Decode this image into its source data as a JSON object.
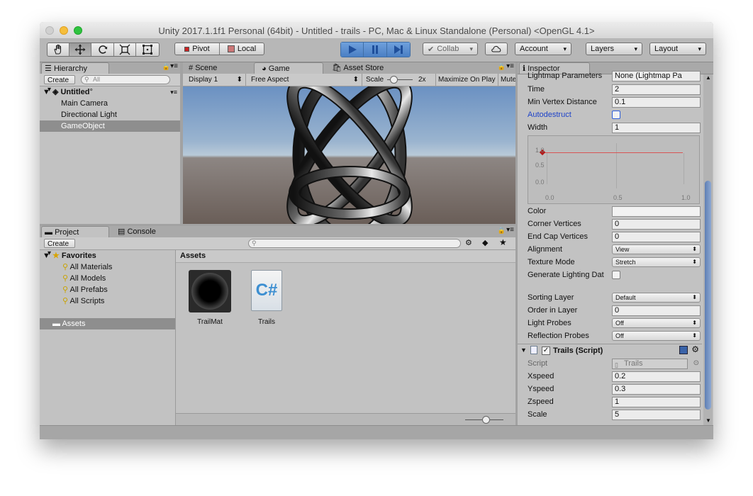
{
  "window": {
    "title": "Unity 2017.1.1f1 Personal (64bit) - Untitled - trails - PC, Mac & Linux Standalone (Personal) <OpenGL 4.1>"
  },
  "toolbar": {
    "tools": [
      "hand-icon",
      "move-icon",
      "rotate-icon",
      "scale-icon",
      "rect-tool-icon"
    ],
    "pivot": "Pivot",
    "local": "Local",
    "collab": "Collab",
    "account": "Account",
    "layers": "Layers",
    "layout": "Layout"
  },
  "hierarchy": {
    "tab": "Hierarchy",
    "create": "Create",
    "search_placeholder": "All",
    "scene_name": "Untitled",
    "items": [
      "Main Camera",
      "Directional Light",
      "GameObject"
    ],
    "selected_index": 2
  },
  "game_view": {
    "tabs": [
      "Scene",
      "Game",
      "Asset Store"
    ],
    "display": "Display 1",
    "aspect": "Free Aspect",
    "scale_label": "Scale",
    "scale_value": "2x",
    "maximize": "Maximize On Play",
    "mute": "Mute",
    "colors": {
      "sky_top": "#6b91c2",
      "sky_bottom": "#b9cad8",
      "ground": "#6a5e58"
    }
  },
  "project": {
    "tabs": [
      "Project",
      "Console"
    ],
    "create": "Create",
    "favorites_label": "Favorites",
    "favorites": [
      "All Materials",
      "All Models",
      "All Prefabs",
      "All Scripts"
    ],
    "assets_folder": "Assets",
    "breadcrumb": "Assets",
    "assets": [
      {
        "name": "TrailMat",
        "icon": "material-sphere-icon"
      },
      {
        "name": "Trails",
        "icon": "csharp-script-icon"
      }
    ]
  },
  "inspector": {
    "tab": "Inspector",
    "cut_row": {
      "label": "Lightmap Parameters",
      "value": "None (Lightmap Pa"
    },
    "trail_rows": [
      {
        "label": "Time",
        "value": "2"
      },
      {
        "label": "Min Vertex Distance",
        "value": "0.1"
      }
    ],
    "autodestruct": {
      "label": "Autodestruct",
      "checked": false
    },
    "width": {
      "label": "Width",
      "value": "1"
    },
    "curve": {
      "y_labels": [
        "1.0",
        "0.5",
        "0.0"
      ],
      "x_labels": [
        "0.0",
        "0.5",
        "1.0"
      ],
      "value": 1.0
    },
    "color": {
      "label": "Color",
      "value": "#f0f0f0"
    },
    "vertex_rows": [
      {
        "label": "Corner Vertices",
        "value": "0"
      },
      {
        "label": "End Cap Vertices",
        "value": "0"
      }
    ],
    "alignment": {
      "label": "Alignment",
      "value": "View"
    },
    "texture_mode": {
      "label": "Texture Mode",
      "value": "Stretch"
    },
    "lighting": {
      "label": "Generate Lighting Dat",
      "checked": false
    },
    "sorting_layer": {
      "label": "Sorting Layer",
      "value": "Default"
    },
    "order_in_layer": {
      "label": "Order in Layer",
      "value": "0"
    },
    "light_probes": {
      "label": "Light Probes",
      "value": "Off"
    },
    "reflection_probes": {
      "label": "Reflection Probes",
      "value": "Off"
    },
    "script_component": {
      "title": "Trails (Script)",
      "script_label": "Script",
      "script_value": "Trails",
      "fields": [
        {
          "label": "Xspeed",
          "value": "0.2"
        },
        {
          "label": "Yspeed",
          "value": "0.3"
        },
        {
          "label": "Zspeed",
          "value": "1"
        },
        {
          "label": "Scale",
          "value": "5"
        }
      ]
    }
  }
}
